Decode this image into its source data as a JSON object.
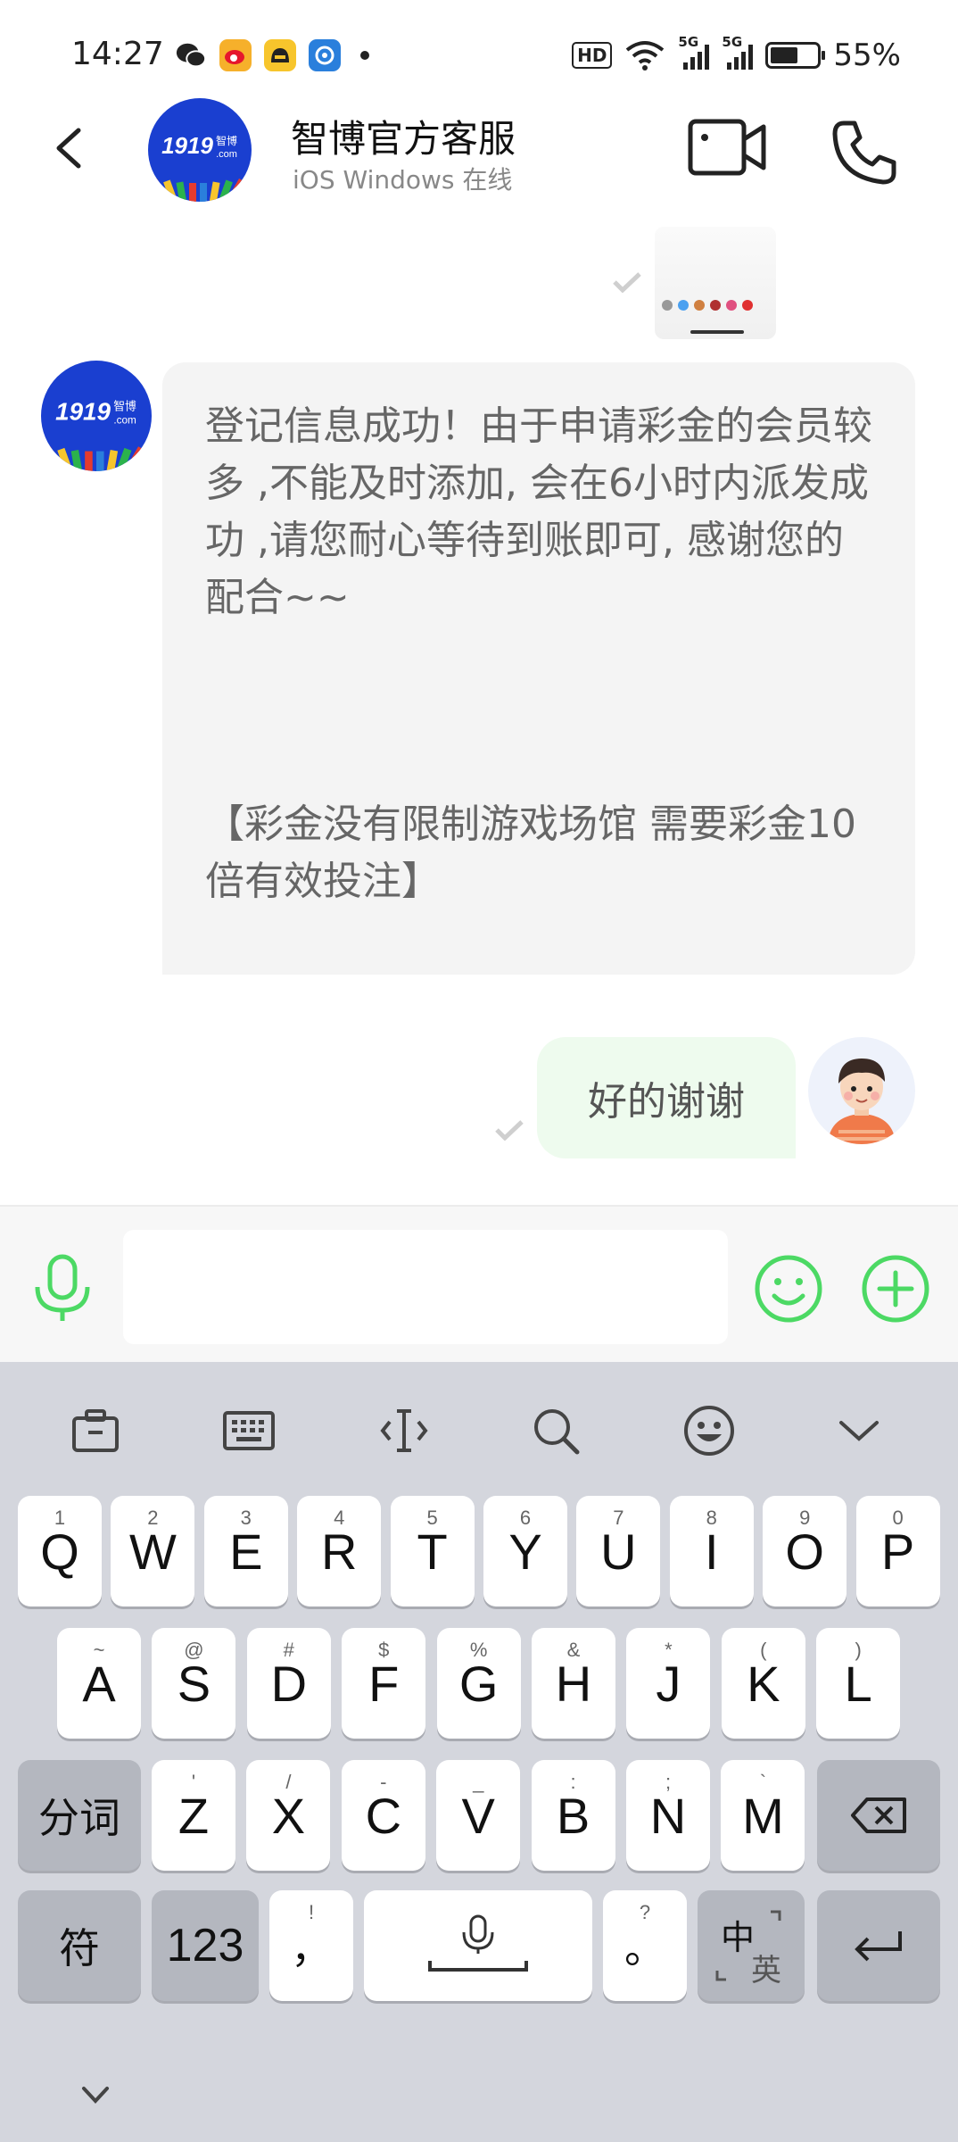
{
  "status_bar": {
    "time": "14:27",
    "battery": "55%",
    "hd": "HD",
    "net1": "5G",
    "net2": "5G"
  },
  "header": {
    "contact_name": "智博官方客服",
    "status": "iOS Windows 在线",
    "avatar_text": "1919",
    "avatar_sub": "智博",
    "avatar_com": ".com"
  },
  "messages": [
    {
      "from": "them",
      "paragraph1": "登记信息成功！由于申请彩金的会员较多 ,不能及时添加, 会在6小时内派发成功 ,请您耐心等待到账即可,  感谢您的配合~~",
      "paragraph2": "【彩金没有限制游戏场馆  需要彩金10倍有效投注】"
    },
    {
      "from": "me",
      "text": "好的谢谢"
    }
  ],
  "input": {
    "placeholder": ""
  },
  "keyboard": {
    "row1": [
      {
        "k": "Q",
        "s": "1"
      },
      {
        "k": "W",
        "s": "2"
      },
      {
        "k": "E",
        "s": "3"
      },
      {
        "k": "R",
        "s": "4"
      },
      {
        "k": "T",
        "s": "5"
      },
      {
        "k": "Y",
        "s": "6"
      },
      {
        "k": "U",
        "s": "7"
      },
      {
        "k": "I",
        "s": "8"
      },
      {
        "k": "O",
        "s": "9"
      },
      {
        "k": "P",
        "s": "0"
      }
    ],
    "row2": [
      {
        "k": "A",
        "s": "~"
      },
      {
        "k": "S",
        "s": "@"
      },
      {
        "k": "D",
        "s": "#"
      },
      {
        "k": "F",
        "s": "$"
      },
      {
        "k": "G",
        "s": "%"
      },
      {
        "k": "H",
        "s": "&"
      },
      {
        "k": "J",
        "s": "*"
      },
      {
        "k": "K",
        "s": "("
      },
      {
        "k": "L",
        "s": ")"
      }
    ],
    "row3": [
      {
        "k": "Z",
        "s": "'"
      },
      {
        "k": "X",
        "s": "/"
      },
      {
        "k": "C",
        "s": "-"
      },
      {
        "k": "V",
        "s": "_"
      },
      {
        "k": "B",
        "s": ":"
      },
      {
        "k": "N",
        "s": ";"
      },
      {
        "k": "M",
        "s": "`"
      }
    ],
    "fenci": "分词",
    "fu": "符",
    "num": "123",
    "comma": "，",
    "comma_sub": "!",
    "period": "。",
    "period_sub": "?",
    "lang_main": "中",
    "lang_sub": "英"
  },
  "colors": {
    "accent_green": "#4cd964",
    "bubble_out": "#eefbee",
    "bubble_in": "#f4f4f4",
    "keyboard_bg": "#d4d6dd"
  }
}
